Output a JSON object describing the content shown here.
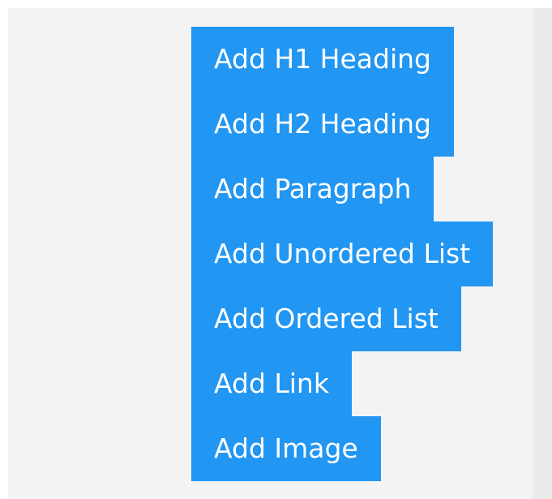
{
  "toolbar": {
    "buttons": [
      {
        "label": "Add H1 Heading"
      },
      {
        "label": "Add H2 Heading"
      },
      {
        "label": "Add Paragraph"
      },
      {
        "label": "Add Unordered List"
      },
      {
        "label": "Add Ordered List"
      },
      {
        "label": "Add Link"
      },
      {
        "label": "Add Image"
      }
    ]
  },
  "colors": {
    "button_background": "#2196f3",
    "button_text": "#ffffff",
    "panel_background": "#f3f3f4"
  }
}
